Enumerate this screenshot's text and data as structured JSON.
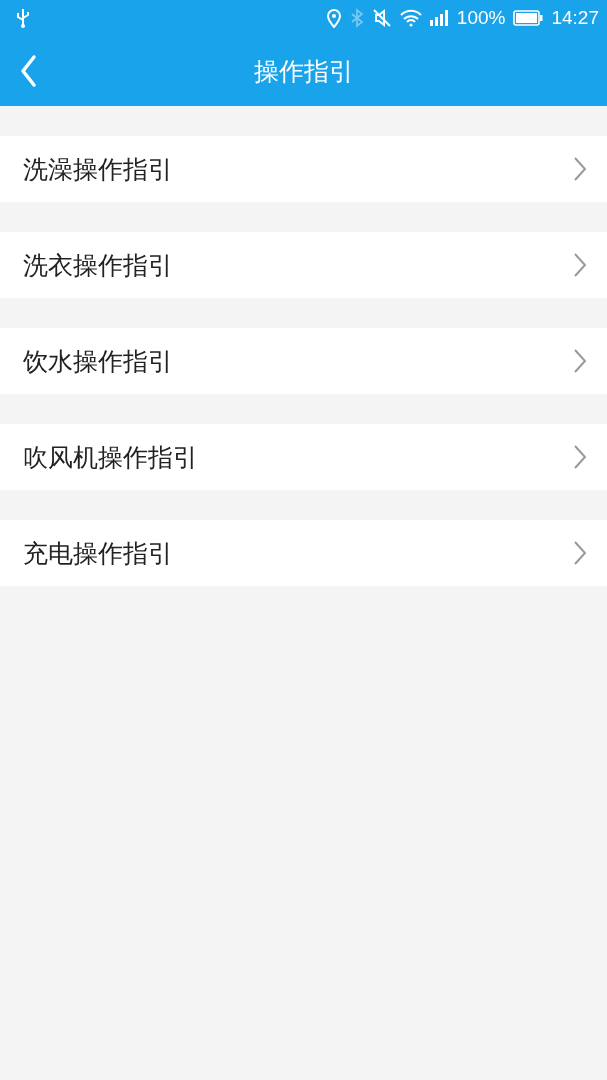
{
  "status_bar": {
    "battery": "100%",
    "time": "14:27"
  },
  "app_bar": {
    "title": "操作指引"
  },
  "items": [
    {
      "label": "洗澡操作指引"
    },
    {
      "label": "洗衣操作指引"
    },
    {
      "label": "饮水操作指引"
    },
    {
      "label": "吹风机操作指引"
    },
    {
      "label": "充电操作指引"
    }
  ]
}
